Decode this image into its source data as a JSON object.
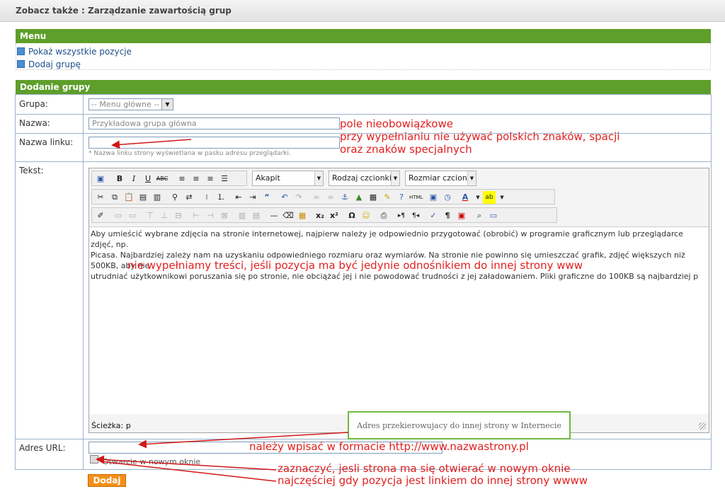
{
  "header": {
    "breadcrumb": "Zobacz także : Zarządzanie zawartością grup"
  },
  "menu": {
    "title": "Menu",
    "links": [
      "Pokaż wszystkie pozycje",
      "Dodaj grupę"
    ]
  },
  "form": {
    "title": "Dodanie grupy",
    "grupa": {
      "label": "Grupa:",
      "value": "-- Menu główne --"
    },
    "nazwa": {
      "label": "Nazwa:",
      "value": "Przykładowa grupa główna"
    },
    "nazwa_linku": {
      "label": "Nazwa linku:",
      "value": "",
      "hint": "* Nazwa linku strony wyświetlana w pasku adresu przeglądarki."
    },
    "tekst": {
      "label": "Tekst:"
    },
    "adres_url": {
      "label": "Adres URL:",
      "value": ""
    },
    "checkbox_label": "Otwarcie w nowym oknie",
    "submit_label": "Dodaj"
  },
  "editor": {
    "format_select": "Akapit",
    "font_select": "Rodzaj czcionki",
    "size_select": "Rozmiar czcionki",
    "content_lines": [
      "Aby umieścić wybrane zdjęcia na stronie internetowej, najpierw należy je odpowiednio przygotować (obrobić) w programie graficznym lub przeglądarce zdjęć, np.",
      "Picasa. Najbardziej zależy nam na uzyskaniu odpowiedniego rozmiaru oraz wymiarów. Na stronie nie powinno się umieszczać grafik, zdjęć większych niż 500KB, aby nie",
      "utrudniać użytkownikowi poruszania się po stronie, nie obciążać jej i nie powodować trudności z jej załadowaniem. Pliki graficzne do 100KB są najbardziej p"
    ],
    "path_label": "Ścieżka: p"
  },
  "tooltip": {
    "text": "Adres przekierowujacy do innej strony w Internecie"
  },
  "annotations": {
    "optional_title": "pole nieobowiązkowe",
    "optional_line2": "przy wypełnianiu nie używać polskich znaków, spacji",
    "optional_line3": "oraz znaków specjalnych",
    "content_note": "nie wypełniamy treści, jeśli pozycja ma być jedynie odnośnikiem do innej strony www",
    "url_note": "należy wpisać w formacie http://www.nazwastrony.pl",
    "checkbox_note1": "zaznaczyć, jesli strona ma się otwierać w nowym oknie",
    "checkbox_note2": "najczęściej gdy pozycja jest linkiem do innej strony wwww"
  },
  "colors": {
    "green_header": "#5e9e2a",
    "annotation_red": "#e21f1f",
    "button_orange": "#f39019"
  }
}
